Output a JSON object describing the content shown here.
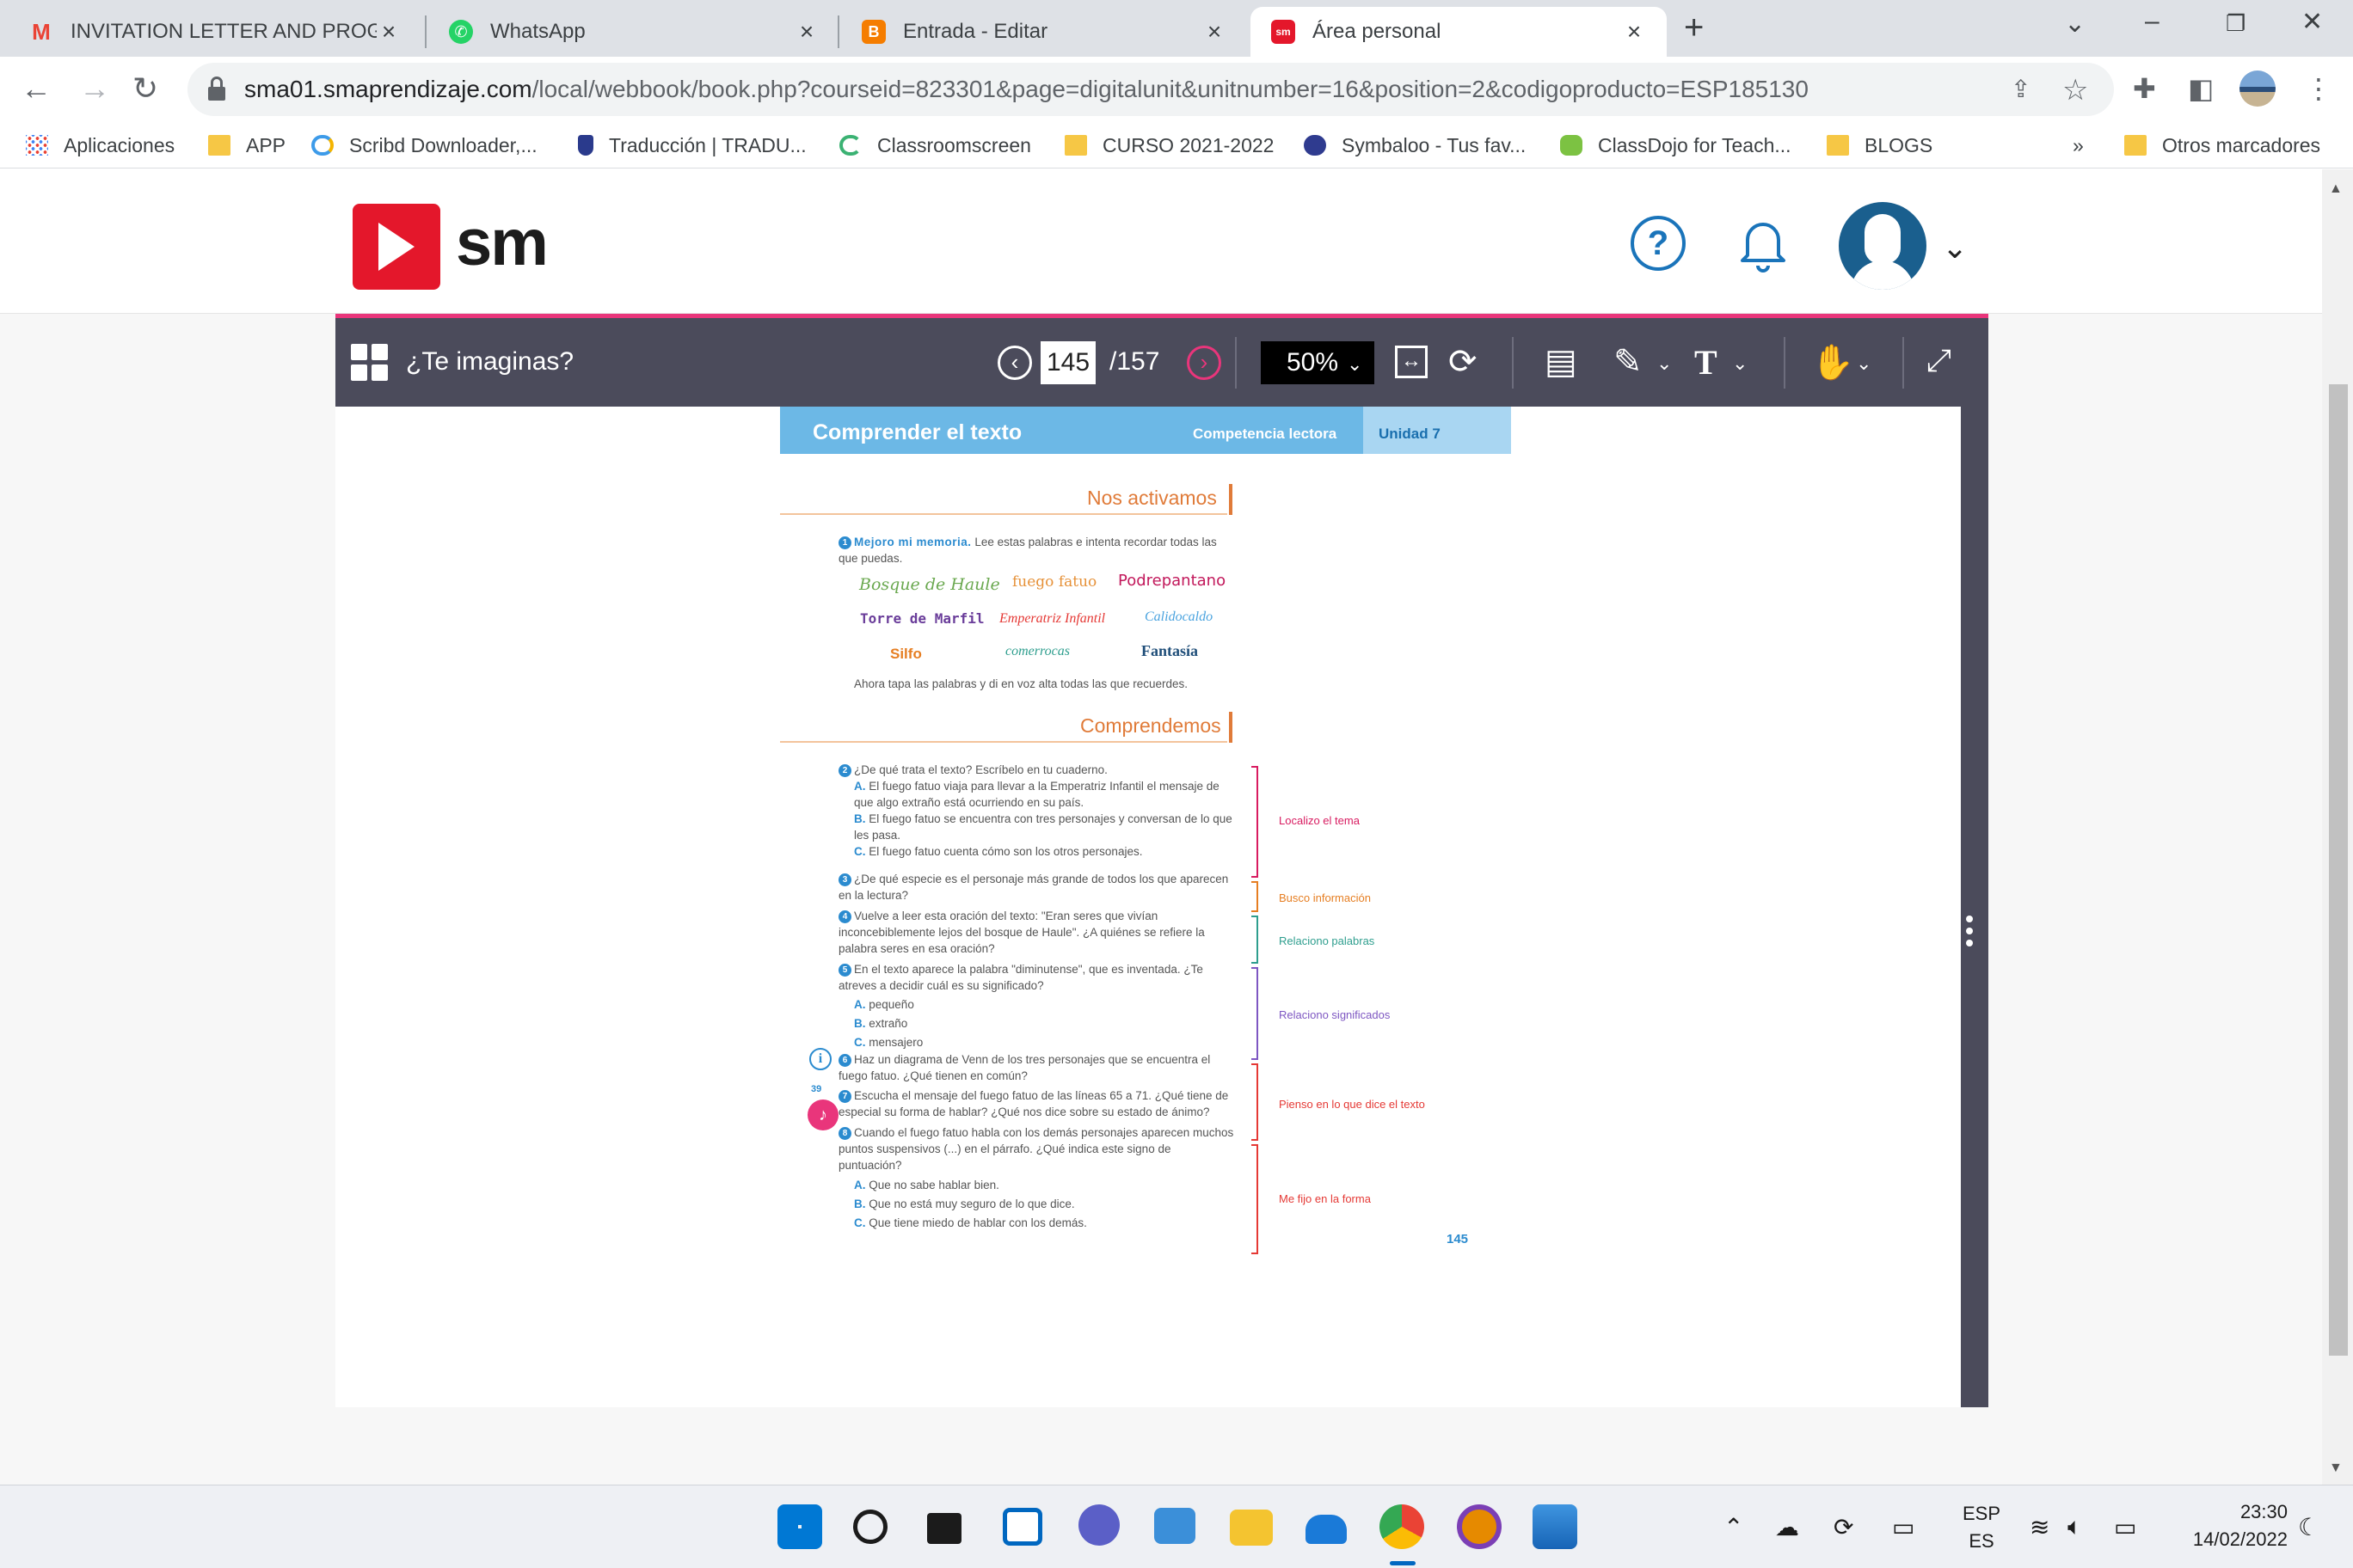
{
  "browser": {
    "tabs": [
      {
        "title": "INVITATION LETTER AND PROGR",
        "icon": "gmail-icon",
        "color": "#ea4335"
      },
      {
        "title": "WhatsApp",
        "icon": "whatsapp-icon",
        "color": "#25d366"
      },
      {
        "title": "Entrada - Editar",
        "icon": "blogger-icon",
        "color": "#f57d00"
      },
      {
        "title": "Área personal",
        "icon": "sm-icon",
        "color": "#e4172b"
      }
    ],
    "url_host": "sma01.smaprendizaje.com",
    "url_path": "/local/webbook/book.php?courseid=823301&page=digitalunit&unitnumber=16&position=2&codigoproducto=ESP185130",
    "bookmarks": [
      "Aplicaciones",
      "APP",
      "Scribd Downloader,...",
      "Traducción | TRADU...",
      "Classroomscreen",
      "CURSO 2021-2022",
      "Symbaloo - Tus fav...",
      "ClassDojo for Teach...",
      "BLOGS"
    ],
    "bookmarks_more": "»",
    "other_bookmarks": "Otros marcadores"
  },
  "site": {
    "logo_text": "sm",
    "help_label": "?"
  },
  "reader": {
    "book_title": "¿Te imaginas?",
    "page_current": "145",
    "page_total": "/157",
    "zoom": "50%"
  },
  "book": {
    "header_title": "Comprender el texto",
    "header_competence": "Competencia lectora",
    "header_unit": "Unidad 7",
    "section1_title": "Nos activamos",
    "q1_lead": "Mejoro mi memoria.",
    "q1_text": "Lee estas palabras e intenta recordar todas las que puedas.",
    "words": [
      {
        "text": "Bosque de Haule",
        "color": "#6aa84f"
      },
      {
        "text": "fuego fatuo",
        "color": "#e69138"
      },
      {
        "text": "Podrepantano",
        "color": "#c2185b"
      },
      {
        "text": "Torre de Marfil",
        "color": "#6a3d9a"
      },
      {
        "text": "Emperatriz Infantil",
        "color": "#e53935"
      },
      {
        "text": "Calidocaldo",
        "color": "#4aa3df"
      },
      {
        "text": "Silfo",
        "color": "#e67e22"
      },
      {
        "text": "comerrocas",
        "color": "#2e9e8e"
      },
      {
        "text": "Fantasía",
        "color": "#1f4e79"
      }
    ],
    "q1_after": "Ahora tapa las palabras y di en voz alta todas las que recuerdes.",
    "section2_title": "Comprendemos",
    "q2": "¿De qué trata el texto? Escríbelo en tu cuaderno.",
    "q2_a": "El fuego fatuo viaja para llevar a la Emperatriz Infantil el mensaje de que algo extraño está ocurriendo en su país.",
    "q2_b": "El fuego fatuo se encuentra con tres personajes y conversan de lo que les pasa.",
    "q2_c": "El fuego fatuo cuenta cómo son los otros personajes.",
    "q3": "¿De qué especie es el personaje más grande de todos los que aparecen en la lectura?",
    "q4": "Vuelve a leer esta oración del texto: \"Eran seres que vivían inconcebiblemente lejos del bosque de Haule\". ¿A quiénes se refiere la palabra seres en esa oración?",
    "q5": "En el texto aparece la palabra \"diminutense\", que es inventada. ¿Te atreves a decidir cuál es su significado?",
    "q5_a": "pequeño",
    "q5_b": "extraño",
    "q5_c": "mensajero",
    "q6": "Haz un diagrama de Venn de los tres personajes que se encuentra el fuego fatuo. ¿Qué tienen en común?",
    "q7": "Escucha el mensaje del fuego fatuo de las líneas 65 a 71. ¿Qué tiene de especial su forma de hablar? ¿Qué nos dice sobre su estado de ánimo?",
    "q8": "Cuando el fuego fatuo habla con los demás personajes aparecen muchos puntos suspensivos (...) en el párrafo. ¿Qué indica este signo de puntuación?",
    "q8_a": "Que no sabe hablar bien.",
    "q8_b": "Que no está muy seguro de lo que dice.",
    "q8_c": "Que tiene miedo de hablar con los demás.",
    "audio_label": "39",
    "categories": [
      {
        "text": "Localizo el tema",
        "color": "#d81b60"
      },
      {
        "text": "Busco información",
        "color": "#e67e22"
      },
      {
        "text": "Relaciono palabras",
        "color": "#2e9e8e"
      },
      {
        "text": "Relaciono significados",
        "color": "#7e57c2"
      },
      {
        "text": "Pienso en lo que dice el texto",
        "color": "#e53935"
      },
      {
        "text": "Me fijo en la forma",
        "color": "#e53935"
      }
    ],
    "page_number": "145"
  },
  "taskbar": {
    "lang_top": "ESP",
    "lang_bottom": "ES",
    "time": "23:30",
    "date": "14/02/2022"
  }
}
